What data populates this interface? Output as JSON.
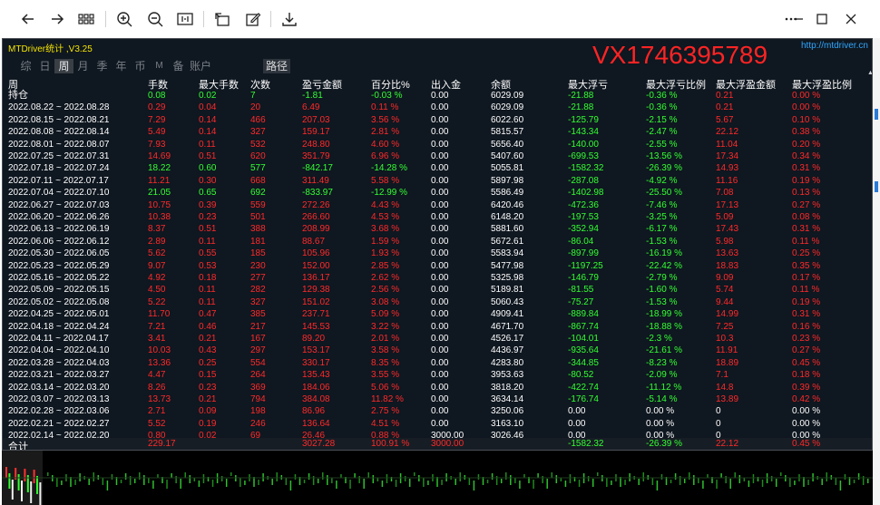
{
  "app": {
    "title": "MTDriver统计 ,V3.25",
    "url": "http://mtdriver.cn",
    "watermark": "VX1746395789"
  },
  "tabs": [
    "综",
    "日",
    "周",
    "月",
    "季",
    "年",
    "币",
    "M",
    "备",
    "账户"
  ],
  "active_tab": "周",
  "path_tab": "路径",
  "columns": [
    "周",
    "手数",
    "最大手数",
    "次数",
    "盈亏金额",
    "百分比%",
    "出入金",
    "余额",
    "最大浮亏",
    "最大浮亏比例",
    "最大浮盈金额",
    "最大浮盈比例"
  ],
  "holding_row": {
    "label": "持仓",
    "values": [
      "0.08",
      "0.02",
      "7",
      "-1.81",
      "-0.03 %",
      "0.00",
      "6029.09",
      "-21.88",
      "-0.36 %",
      "0.21",
      "0.00 %"
    ]
  },
  "rows": [
    {
      "label": "2022.08.22 ~ 2022.08.28",
      "values": [
        "0.29",
        "0.04",
        "20",
        "6.49",
        "0.11 %",
        "0.00",
        "6029.09",
        "-21.88",
        "-0.36 %",
        "0.21",
        "0.00 %"
      ],
      "color": "red"
    },
    {
      "label": "2022.08.15 ~ 2022.08.21",
      "values": [
        "7.29",
        "0.14",
        "466",
        "207.03",
        "3.56 %",
        "0.00",
        "6022.60",
        "-125.79",
        "-2.15 %",
        "5.67",
        "0.10 %"
      ],
      "color": "red"
    },
    {
      "label": "2022.08.08 ~ 2022.08.14",
      "values": [
        "5.49",
        "0.14",
        "327",
        "159.17",
        "2.81 %",
        "0.00",
        "5815.57",
        "-143.34",
        "-2.47 %",
        "22.12",
        "0.38 %"
      ],
      "color": "red"
    },
    {
      "label": "2022.08.01 ~ 2022.08.07",
      "values": [
        "7.93",
        "0.11",
        "532",
        "248.80",
        "4.60 %",
        "0.00",
        "5656.40",
        "-140.00",
        "-2.55 %",
        "11.04",
        "0.20 %"
      ],
      "color": "red"
    },
    {
      "label": "2022.07.25 ~ 2022.07.31",
      "values": [
        "14.69",
        "0.51",
        "620",
        "351.79",
        "6.96 %",
        "0.00",
        "5407.60",
        "-699.53",
        "-13.56 %",
        "17.34",
        "0.34 %"
      ],
      "color": "red"
    },
    {
      "label": "2022.07.18 ~ 2022.07.24",
      "values": [
        "18.22",
        "0.60",
        "577",
        "-842.17",
        "-14.28 %",
        "0.00",
        "5055.81",
        "-1582.32",
        "-26.39 %",
        "14.93",
        "0.31 %"
      ],
      "color": "green"
    },
    {
      "label": "2022.07.11 ~ 2022.07.17",
      "values": [
        "11.21",
        "0.30",
        "668",
        "311.49",
        "5.58 %",
        "0.00",
        "5897.98",
        "-287.08",
        "-4.92 %",
        "11.16",
        "0.19 %"
      ],
      "color": "red"
    },
    {
      "label": "2022.07.04 ~ 2022.07.10",
      "values": [
        "21.05",
        "0.65",
        "692",
        "-833.97",
        "-12.99 %",
        "0.00",
        "5586.49",
        "-1402.98",
        "-25.50 %",
        "7.08",
        "0.13 %"
      ],
      "color": "green"
    },
    {
      "label": "2022.06.27 ~ 2022.07.03",
      "values": [
        "10.75",
        "0.39",
        "559",
        "272.26",
        "4.43 %",
        "0.00",
        "6420.46",
        "-472.36",
        "-7.46 %",
        "17.13",
        "0.27 %"
      ],
      "color": "red"
    },
    {
      "label": "2022.06.20 ~ 2022.06.26",
      "values": [
        "10.38",
        "0.23",
        "501",
        "266.60",
        "4.53 %",
        "0.00",
        "6148.20",
        "-197.53",
        "-3.25 %",
        "5.09",
        "0.08 %"
      ],
      "color": "red"
    },
    {
      "label": "2022.06.13 ~ 2022.06.19",
      "values": [
        "8.37",
        "0.51",
        "388",
        "208.99",
        "3.68 %",
        "0.00",
        "5881.60",
        "-352.94",
        "-6.17 %",
        "17.43",
        "0.31 %"
      ],
      "color": "red"
    },
    {
      "label": "2022.06.06 ~ 2022.06.12",
      "values": [
        "2.89",
        "0.11",
        "181",
        "88.67",
        "1.59 %",
        "0.00",
        "5672.61",
        "-86.04",
        "-1.53 %",
        "5.98",
        "0.11 %"
      ],
      "color": "red"
    },
    {
      "label": "2022.05.30 ~ 2022.06.05",
      "values": [
        "5.62",
        "0.55",
        "185",
        "105.96",
        "1.93 %",
        "0.00",
        "5583.94",
        "-897.99",
        "-16.19 %",
        "13.63",
        "0.25 %"
      ],
      "color": "red"
    },
    {
      "label": "2022.05.23 ~ 2022.05.29",
      "values": [
        "9.07",
        "0.53",
        "230",
        "152.00",
        "2.85 %",
        "0.00",
        "5477.98",
        "-1197.25",
        "-22.42 %",
        "18.83",
        "0.35 %"
      ],
      "color": "red"
    },
    {
      "label": "2022.05.16 ~ 2022.05.22",
      "values": [
        "4.92",
        "0.18",
        "277",
        "136.17",
        "2.62 %",
        "0.00",
        "5325.98",
        "-146.79",
        "-2.79 %",
        "9.09",
        "0.17 %"
      ],
      "color": "red"
    },
    {
      "label": "2022.05.09 ~ 2022.05.15",
      "values": [
        "4.50",
        "0.11",
        "282",
        "129.38",
        "2.56 %",
        "0.00",
        "5189.81",
        "-81.55",
        "-1.60 %",
        "5.74",
        "0.11 %"
      ],
      "color": "red"
    },
    {
      "label": "2022.05.02 ~ 2022.05.08",
      "values": [
        "5.22",
        "0.11",
        "327",
        "151.02",
        "3.08 %",
        "0.00",
        "5060.43",
        "-75.27",
        "-1.53 %",
        "9.44",
        "0.19 %"
      ],
      "color": "red"
    },
    {
      "label": "2022.04.25 ~ 2022.05.01",
      "values": [
        "11.70",
        "0.47",
        "385",
        "237.71",
        "5.09 %",
        "0.00",
        "4909.41",
        "-889.84",
        "-18.99 %",
        "14.99",
        "0.31 %"
      ],
      "color": "red"
    },
    {
      "label": "2022.04.18 ~ 2022.04.24",
      "values": [
        "7.21",
        "0.46",
        "217",
        "145.53",
        "3.22 %",
        "0.00",
        "4671.70",
        "-867.74",
        "-18.88 %",
        "7.25",
        "0.16 %"
      ],
      "color": "red"
    },
    {
      "label": "2022.04.11 ~ 2022.04.17",
      "values": [
        "3.41",
        "0.21",
        "167",
        "89.20",
        "2.01 %",
        "0.00",
        "4526.17",
        "-104.01",
        "-2.3 %",
        "10.3",
        "0.23 %"
      ],
      "color": "red"
    },
    {
      "label": "2022.04.04 ~ 2022.04.10",
      "values": [
        "10.03",
        "0.43",
        "297",
        "153.17",
        "3.58 %",
        "0.00",
        "4436.97",
        "-935.64",
        "-21.61 %",
        "11.91",
        "0.27 %"
      ],
      "color": "red"
    },
    {
      "label": "2022.03.28 ~ 2022.04.03",
      "values": [
        "13.36",
        "0.25",
        "554",
        "330.17",
        "8.35 %",
        "0.00",
        "4283.80",
        "-344.85",
        "-8.23 %",
        "18.89",
        "0.45 %"
      ],
      "color": "red"
    },
    {
      "label": "2022.03.21 ~ 2022.03.27",
      "values": [
        "4.47",
        "0.15",
        "264",
        "135.43",
        "3.55 %",
        "0.00",
        "3953.63",
        "-80.52",
        "-2.09 %",
        "7.1",
        "0.18 %"
      ],
      "color": "red"
    },
    {
      "label": "2022.03.14 ~ 2022.03.20",
      "values": [
        "8.26",
        "0.23",
        "369",
        "184.06",
        "5.06 %",
        "0.00",
        "3818.20",
        "-422.74",
        "-11.12 %",
        "14.8",
        "0.39 %"
      ],
      "color": "red"
    },
    {
      "label": "2022.03.07 ~ 2022.03.13",
      "values": [
        "13.73",
        "0.21",
        "794",
        "384.08",
        "11.82 %",
        "0.00",
        "3634.14",
        "-176.74",
        "-5.14 %",
        "13.89",
        "0.42 %"
      ],
      "color": "red"
    },
    {
      "label": "2022.02.28 ~ 2022.03.06",
      "values": [
        "2.71",
        "0.09",
        "198",
        "86.96",
        "2.75 %",
        "0.00",
        "3250.06",
        "0.00",
        "0.00 %",
        "0",
        "0.00 %"
      ],
      "color": "red"
    },
    {
      "label": "2022.02.21 ~ 2022.02.27",
      "values": [
        "5.52",
        "0.19",
        "246",
        "136.64",
        "4.51 %",
        "0.00",
        "3163.10",
        "0.00",
        "0.00 %",
        "0",
        "0.00 %"
      ],
      "color": "red"
    },
    {
      "label": "2022.02.14 ~ 2022.02.20",
      "values": [
        "0.80",
        "0.02",
        "69",
        "26.46",
        "0.88 %",
        "3000.00",
        "3026.46",
        "0.00",
        "0.00 %",
        "0",
        "0.00 %"
      ],
      "color": "red"
    }
  ],
  "totals": {
    "label": "合计",
    "lots": "229.17",
    "profit": "3027.28",
    "percent": "100.91 %",
    "deposit": "3000.00",
    "max_float_loss": "-1582.32",
    "max_float_loss_pct": "-26.39 %",
    "max_float_profit": "22.12",
    "max_float_profit_pct": "0.45 %"
  },
  "colors": {
    "background": "#0f1720",
    "profit": "#ff2a2a",
    "loss": "#33ff33",
    "title": "#f5e400",
    "link": "#2ea8ff"
  },
  "icons": [
    "back-arrow-icon",
    "forward-arrow-icon",
    "grid-icon",
    "zoom-in-icon",
    "zoom-out-icon",
    "fit-width-icon",
    "rotate-icon",
    "edit-icon",
    "save-icon",
    "more-icon",
    "minimize-icon",
    "maximize-icon",
    "close-icon"
  ]
}
